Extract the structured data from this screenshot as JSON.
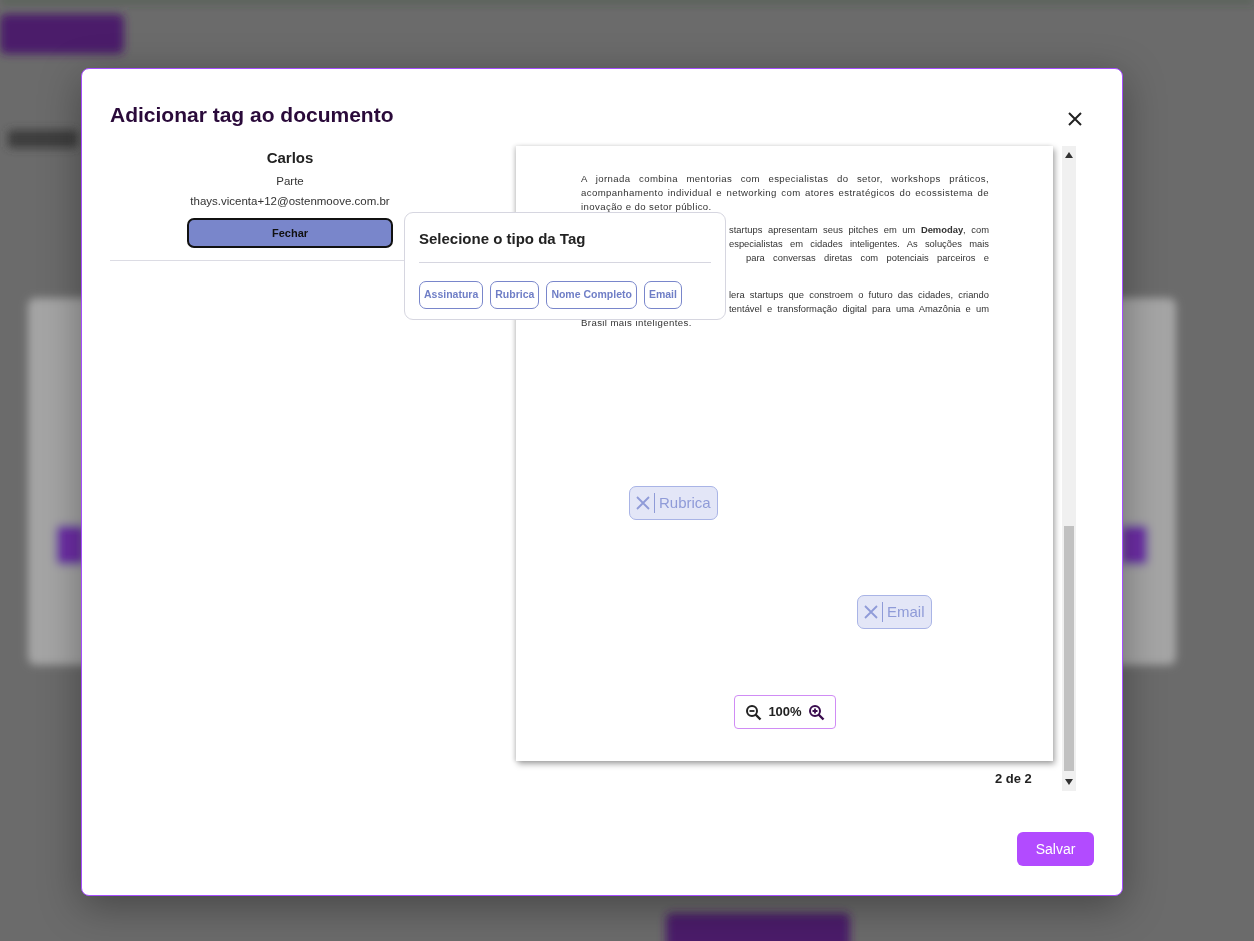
{
  "modal": {
    "title": "Adicionar tag ao documento"
  },
  "signer": {
    "name": "Carlos",
    "role": "Parte",
    "email": "thays.vicenta+12@ostenmoove.com.br",
    "close_button": "Fechar"
  },
  "tag_picker": {
    "title": "Selecione o tipo da Tag",
    "options": [
      "Assinatura",
      "Rubrica",
      "Nome Completo",
      "Email"
    ]
  },
  "document": {
    "blocks": [
      {
        "kind": "full",
        "text": "A jornada combina mentorias com especialistas do setor, workshops práticos, acompanhamento individual e networking com atores estratégicos do ecossistema de inovação e do setor público."
      },
      {
        "kind": "partial",
        "lines": [
          "startups apresentam seus pitches em um **Demoday**, com",
          "especialistas em cidades inteligentes. As soluções mais",
          "para conversas diretas com potenciais parceiros e"
        ]
      },
      {
        "kind": "partial",
        "lines": [
          "lera startups que constroem o futuro das cidades, criando",
          "tentável e transformação digital para uma Amazônia e um"
        ],
        "tail": "Brasil mais inteligentes."
      }
    ],
    "placed_tags": [
      {
        "label": "Rubrica"
      },
      {
        "label": "Email"
      }
    ],
    "zoom": "100%",
    "page_indicator": "2 de 2"
  },
  "save_button": "Salvar"
}
